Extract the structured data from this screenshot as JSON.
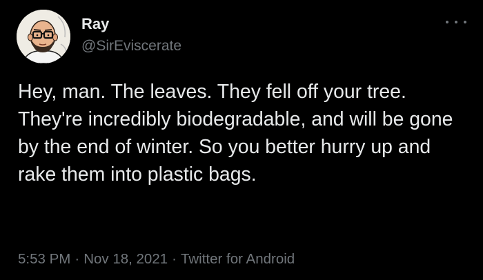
{
  "tweet": {
    "author": {
      "name": "Ray",
      "handle": "@SirEviscerate",
      "avatar_icon": "cartoon-avatar-bald-glasses-beard"
    },
    "more_icon": "more-horizontal-icon",
    "text": "Hey, man. The leaves. They fell off your tree. They're incredibly biodegradable, and will be gone by the end of winter. So you better hurry up and rake them into plastic bags.",
    "time": "5:53 PM",
    "date": "Nov 18, 2021",
    "separator": "·",
    "source": "Twitter for Android"
  },
  "colors": {
    "background": "#000000",
    "primary_text": "#e7e9ea",
    "secondary_text": "#71767b"
  }
}
